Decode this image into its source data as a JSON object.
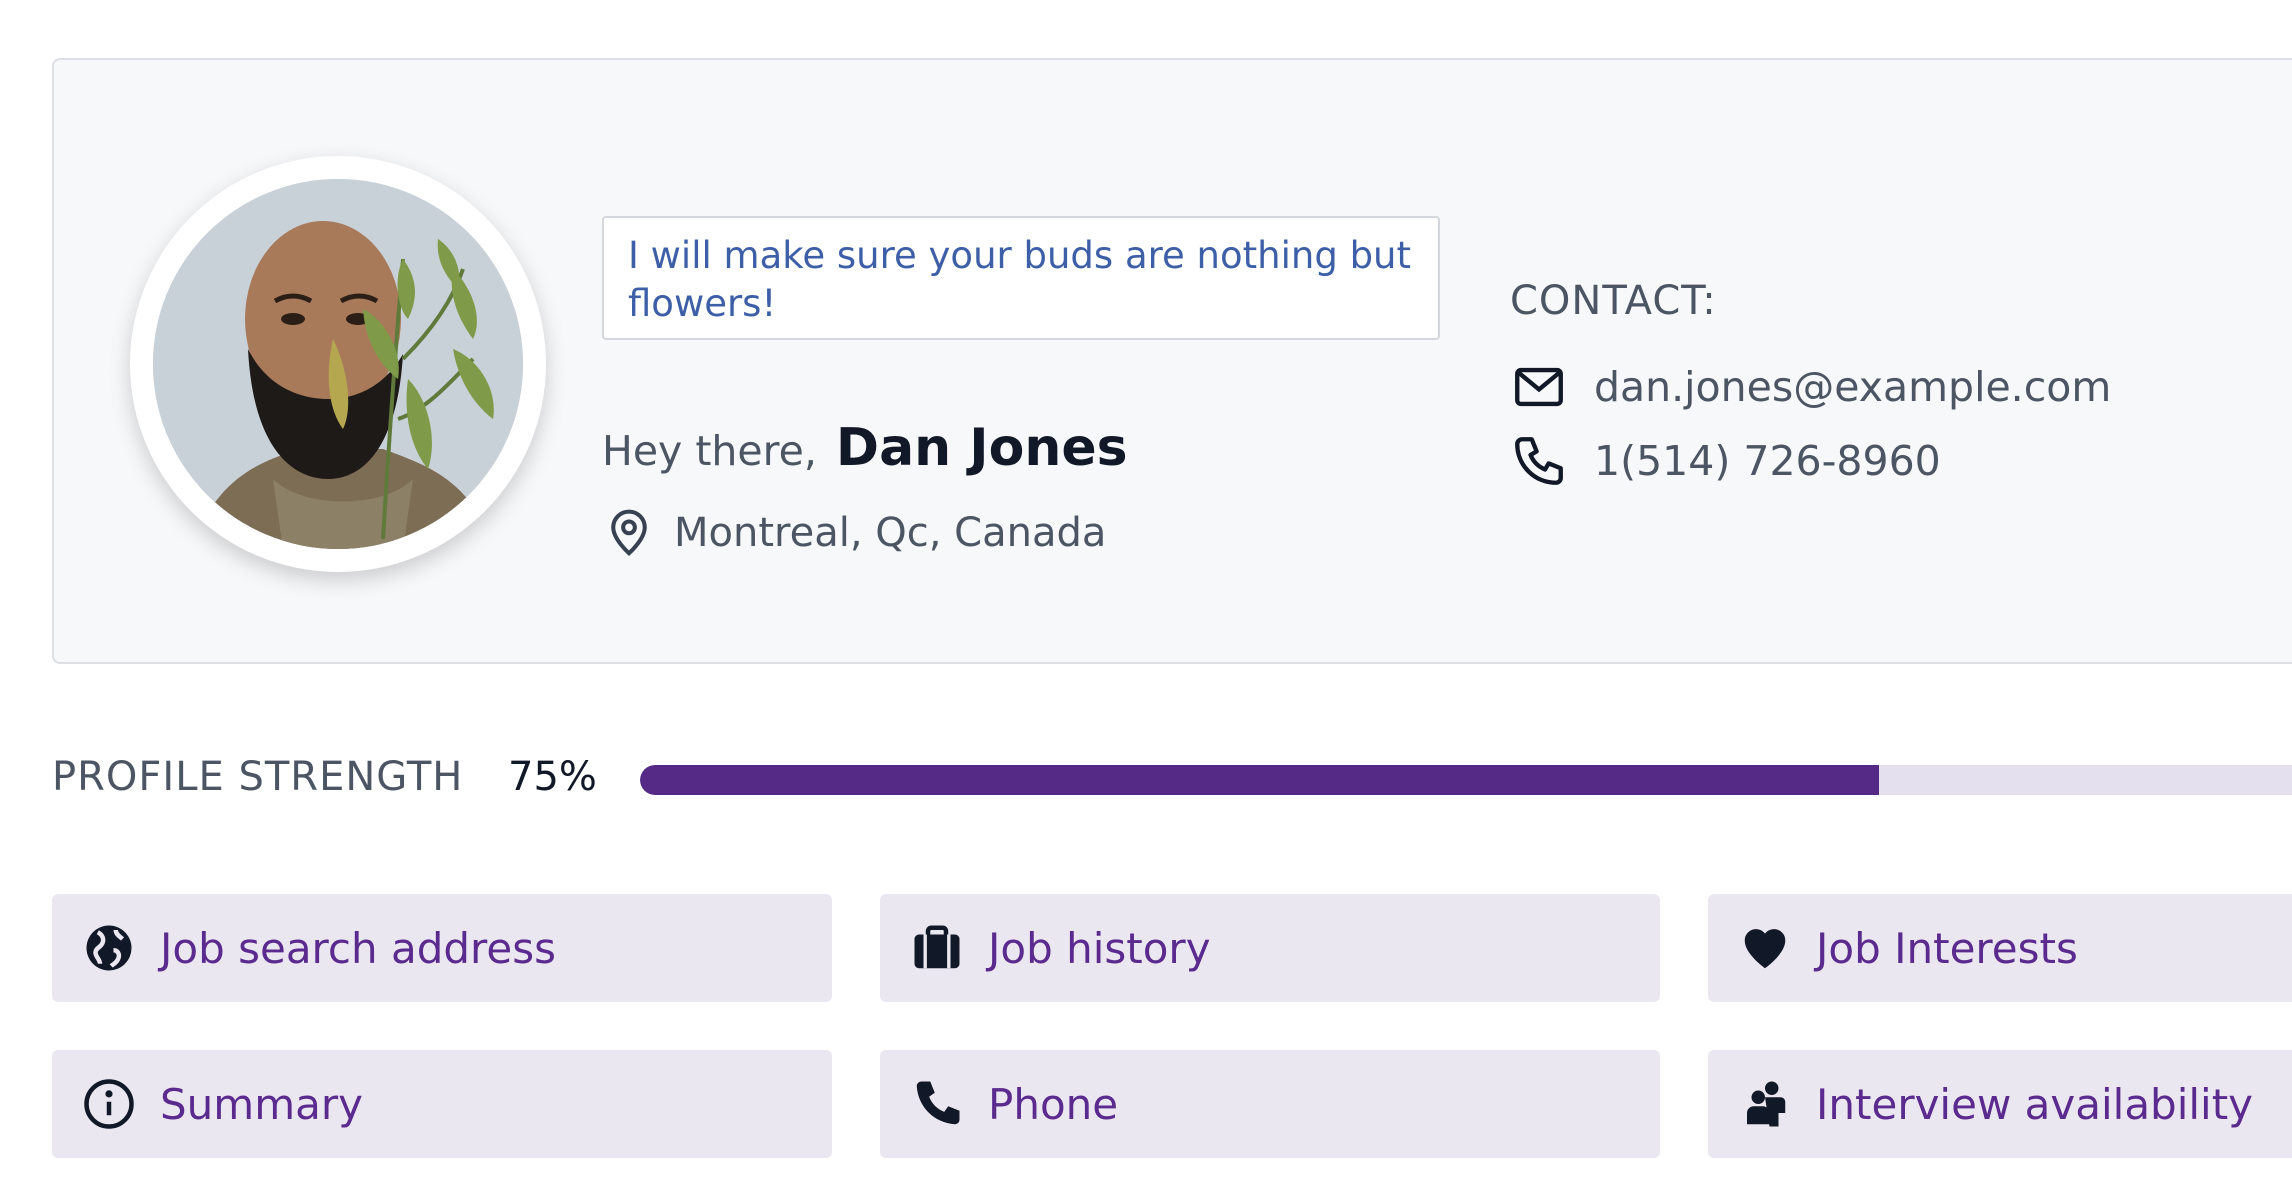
{
  "profile": {
    "tagline": "I will make sure your buds are nothing but flowers!",
    "greeting": "Hey there,",
    "name": "Dan Jones",
    "location": "Montreal, Qc, Canada",
    "avatar_icon": "profile-photo"
  },
  "contact": {
    "title": "CONTACT:",
    "email": "dan.jones@example.com",
    "phone": "1(514) 726-8960",
    "email_icon": "envelope-icon",
    "phone_icon": "phone-icon"
  },
  "strength": {
    "label": "PROFILE STRENGTH",
    "value_text": "75%",
    "value": 0.75,
    "bar_color": "#542a86"
  },
  "sections": [
    {
      "label": "Job search address",
      "icon": "globe-icon"
    },
    {
      "label": "Job history",
      "icon": "briefcase-icon"
    },
    {
      "label": "Job Interests",
      "icon": "heart-icon"
    },
    {
      "label": "Summary",
      "icon": "info-icon"
    },
    {
      "label": "Phone",
      "icon": "phone-icon"
    },
    {
      "label": "Interview availability",
      "icon": "people-icon"
    }
  ],
  "colors": {
    "accent": "#5b2a8e",
    "tile_bg": "#ebe7f1",
    "card_bg": "#f7f8fa",
    "tagline_text": "#3d5fa8"
  }
}
